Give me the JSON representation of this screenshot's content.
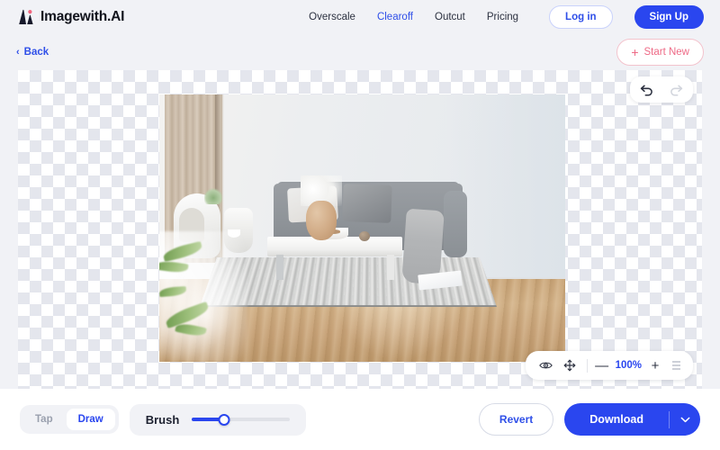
{
  "header": {
    "brand": "Imagewith.AI",
    "brand_icon": "mountain-logo-icon",
    "nav": [
      {
        "label": "Overscale",
        "active": false
      },
      {
        "label": "Clearoff",
        "active": true
      },
      {
        "label": "Outcut",
        "active": false
      },
      {
        "label": "Pricing",
        "active": false
      }
    ],
    "login_label": "Log in",
    "signup_label": "Sign Up"
  },
  "subbar": {
    "back_label": "Back",
    "back_chevron": "‹",
    "start_new_label": "Start New",
    "start_new_plus": "+"
  },
  "canvas": {
    "history": {
      "undo_icon": "undo-arrow-icon",
      "redo_icon": "redo-arrow-icon"
    },
    "zoom_toolbar": {
      "preview_icon": "eye-icon",
      "pan_icon": "move-icon",
      "minus_label": "—",
      "zoom_value": "100%",
      "plus_label": "+",
      "menu_icon": "hamburger-menu-icon"
    }
  },
  "bottombar": {
    "modes": [
      {
        "label": "Tap",
        "active": false
      },
      {
        "label": "Draw",
        "active": true
      }
    ],
    "brush": {
      "label": "Brush",
      "value_percent": 33
    },
    "revert_label": "Revert",
    "download_label": "Download",
    "download_caret": "⌄"
  },
  "colors": {
    "accent_blue": "#2a46ef",
    "link_blue": "#2f4fe8",
    "start_new_pink": "#ee6a86",
    "page_bg": "#f1f2f6"
  }
}
